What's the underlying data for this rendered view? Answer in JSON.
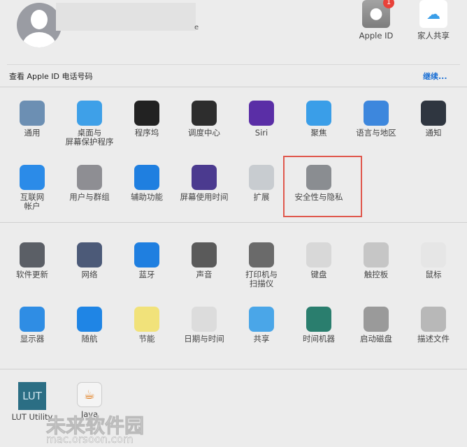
{
  "account": {
    "name_suffix": "e",
    "top_items": [
      {
        "label": "Apple ID",
        "badge": "1",
        "icon": "apple-icon"
      },
      {
        "label": "家人共享",
        "icon": "family-sharing-icon"
      }
    ]
  },
  "notice": {
    "text": "查看 Apple ID 电话号码",
    "action": "继续..."
  },
  "section1": [
    {
      "label": "通用",
      "icon": "general-icon",
      "color": "#6c8fb3"
    },
    {
      "label": "桌面与\n屏幕保护程序",
      "icon": "desktop-icon",
      "color": "#3ea0e8"
    },
    {
      "label": "程序坞",
      "icon": "dock-icon",
      "color": "#222222"
    },
    {
      "label": "调度中心",
      "icon": "mission-control-icon",
      "color": "#2d2d2d"
    },
    {
      "label": "Siri",
      "icon": "siri-icon",
      "color": "#5a2ea6"
    },
    {
      "label": "聚焦",
      "icon": "spotlight-icon",
      "color": "#3a9ee8"
    },
    {
      "label": "语言与地区",
      "icon": "language-region-icon",
      "color": "#3d87dd"
    },
    {
      "label": "通知",
      "icon": "notifications-icon",
      "color": "#2f3640"
    },
    {
      "label": "互联网\n帐户",
      "icon": "internet-accounts-icon",
      "color": "#2b8be8"
    },
    {
      "label": "用户与群组",
      "icon": "users-groups-icon",
      "color": "#8e8e93"
    },
    {
      "label": "辅助功能",
      "icon": "accessibility-icon",
      "color": "#1f7fe0"
    },
    {
      "label": "屏幕使用时间",
      "icon": "screen-time-icon",
      "color": "#4b3a8f"
    },
    {
      "label": "扩展",
      "icon": "extensions-icon",
      "color": "#c8ccd0"
    },
    {
      "label": "安全性与隐私",
      "icon": "security-privacy-icon",
      "color": "#8a8d91",
      "highlighted": true
    }
  ],
  "section2": [
    {
      "label": "软件更新",
      "icon": "software-update-icon",
      "color": "#5b5f66"
    },
    {
      "label": "网络",
      "icon": "network-icon",
      "color": "#4c5a78"
    },
    {
      "label": "蓝牙",
      "icon": "bluetooth-icon",
      "color": "#1f7fe0"
    },
    {
      "label": "声音",
      "icon": "sound-icon",
      "color": "#5a5a5a"
    },
    {
      "label": "打印机与\n扫描仪",
      "icon": "printers-icon",
      "color": "#6a6a6a"
    },
    {
      "label": "键盘",
      "icon": "keyboard-icon",
      "color": "#d8d8d8"
    },
    {
      "label": "触控板",
      "icon": "trackpad-icon",
      "color": "#c6c6c6"
    },
    {
      "label": "鼠标",
      "icon": "mouse-icon",
      "color": "#e6e6e6"
    },
    {
      "label": "显示器",
      "icon": "displays-icon",
      "color": "#2f8de4"
    },
    {
      "label": "随航",
      "icon": "sidecar-icon",
      "color": "#1f85e5"
    },
    {
      "label": "节能",
      "icon": "energy-saver-icon",
      "color": "#f1e27a"
    },
    {
      "label": "日期与时间",
      "icon": "date-time-icon",
      "color": "#dcdcdc"
    },
    {
      "label": "共享",
      "icon": "sharing-icon",
      "color": "#4aa6e8"
    },
    {
      "label": "时间机器",
      "icon": "time-machine-icon",
      "color": "#2a7e6e"
    },
    {
      "label": "启动磁盘",
      "icon": "startup-disk-icon",
      "color": "#9a9a9a"
    },
    {
      "label": "描述文件",
      "icon": "profiles-icon",
      "color": "#b8b8b8"
    }
  ],
  "section3": [
    {
      "label": "LUT Utility",
      "icon_text": "LUT",
      "icon": "lut-utility-icon",
      "color": "#2b6e84"
    },
    {
      "label": "Java",
      "icon": "java-icon",
      "color": "#f4f4f4"
    }
  ],
  "watermark": {
    "line1": "未来软件园",
    "line2": "mac.orsoon.com"
  }
}
